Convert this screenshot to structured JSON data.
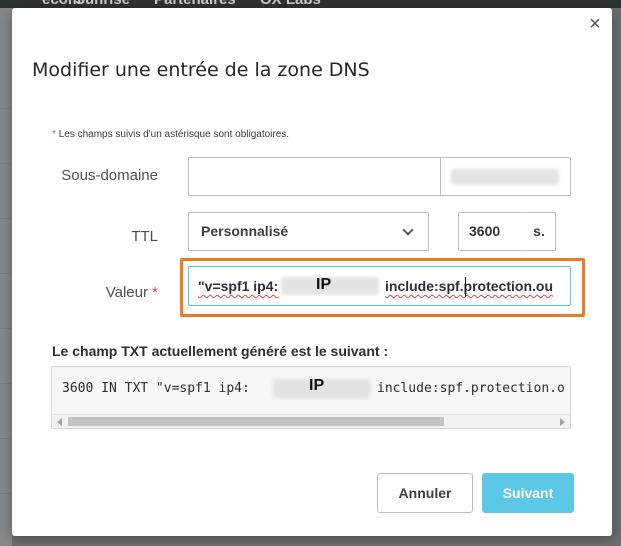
{
  "background": {
    "nav_items": [
      "ecom",
      "Sunrise",
      "Partenaires",
      "OX Labs"
    ]
  },
  "modal": {
    "title": "Modifier une entrée de la zone DNS",
    "close_label": "×",
    "required_note": "Les champs suivis d'un astérisque sont obligatoires.",
    "required_star": "*",
    "fields": {
      "subdomain": {
        "label": "Sous-domaine",
        "value": ""
      },
      "ttl": {
        "label": "TTL",
        "selected": "Personnalisé",
        "value": "3600",
        "unit": "s."
      },
      "value": {
        "label": "Valeur",
        "star": "*",
        "text_before": "\"v=spf1 ip4:",
        "ip_mark": "IP",
        "text_after": "include:spf.protection.ou"
      }
    },
    "generated": {
      "label": "Le champ TXT actuellement généré est le suivant :",
      "text_before": "3600 IN TXT \"v=spf1 ip4:",
      "ip_mark": "IP",
      "text_after": "include:spf.protection.o"
    },
    "buttons": {
      "cancel": "Annuler",
      "next": "Suivant"
    }
  }
}
